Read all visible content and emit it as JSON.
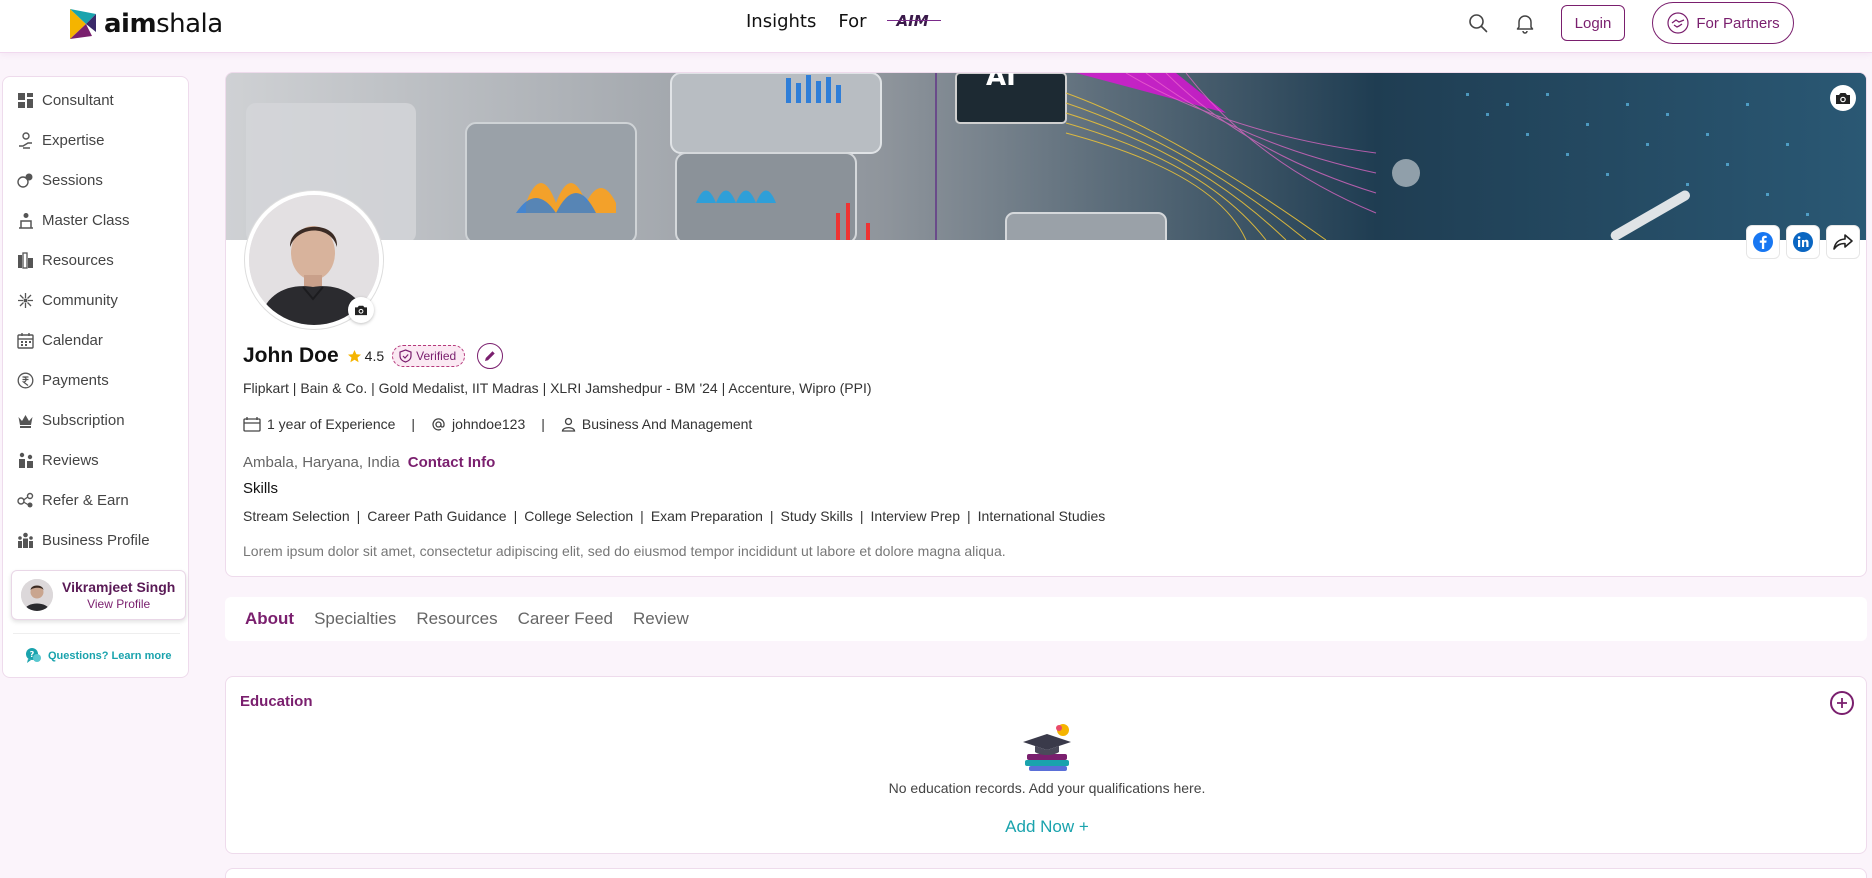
{
  "header": {
    "logo_text_bold": "aim",
    "logo_text_light": "shala",
    "nav": [
      "Insights",
      "For"
    ],
    "aim_badge": "AIM",
    "login_label": "Login",
    "partners_label": "For Partners",
    "icons": [
      "search-icon",
      "bell-icon"
    ]
  },
  "sidebar": {
    "items": [
      {
        "label": "Consultant",
        "icon": "dashboard-icon"
      },
      {
        "label": "Expertise",
        "icon": "hand-icon"
      },
      {
        "label": "Sessions",
        "icon": "sessions-icon"
      },
      {
        "label": "Master Class",
        "icon": "masterclass-icon"
      },
      {
        "label": "Resources",
        "icon": "resources-icon"
      },
      {
        "label": "Community",
        "icon": "community-icon"
      },
      {
        "label": "Calendar",
        "icon": "calendar-icon"
      },
      {
        "label": "Payments",
        "icon": "rupee-icon"
      },
      {
        "label": "Subscription",
        "icon": "crown-icon"
      },
      {
        "label": "Reviews",
        "icon": "reviews-icon"
      },
      {
        "label": "Refer & Earn",
        "icon": "refer-icon"
      },
      {
        "label": "Business Profile",
        "icon": "business-icon"
      }
    ],
    "profile": {
      "name": "Vikramjeet Singh",
      "link": "View Profile"
    },
    "questions": "Questions? Learn more"
  },
  "profile": {
    "name": "John Doe",
    "rating": "4.5",
    "verified": "Verified",
    "headline": "Flipkart | Bain & Co. | Gold Medalist, IIT Madras | XLRI Jamshedpur - BM '24 | Accenture, Wipro (PPI)",
    "experience": "1 year of Experience",
    "username": "johndoe123",
    "category": "Business And Management",
    "location": "Ambala, Haryana, India",
    "contact_label": "Contact Info",
    "skills_title": "Skills",
    "skills": [
      "Stream Selection",
      "Career Path Guidance",
      "College Selection",
      "Exam Preparation",
      "Study Skills",
      "Interview Prep",
      "International Studies"
    ],
    "bio": "Lorem ipsum dolor sit amet, consectetur adipiscing elit, sed do eiusmod tempor incididunt ut labore et dolore magna aliqua."
  },
  "tabs": [
    "About",
    "Specialties",
    "Resources",
    "Career Feed",
    "Review"
  ],
  "active_tab": "About",
  "education": {
    "title": "Education",
    "empty_message": "No education records. Add your qualifications here.",
    "add_label": "Add Now  +"
  },
  "colors": {
    "brand": "#7a1f6e",
    "accent": "#1aa3ad",
    "star": "#f5b400"
  }
}
